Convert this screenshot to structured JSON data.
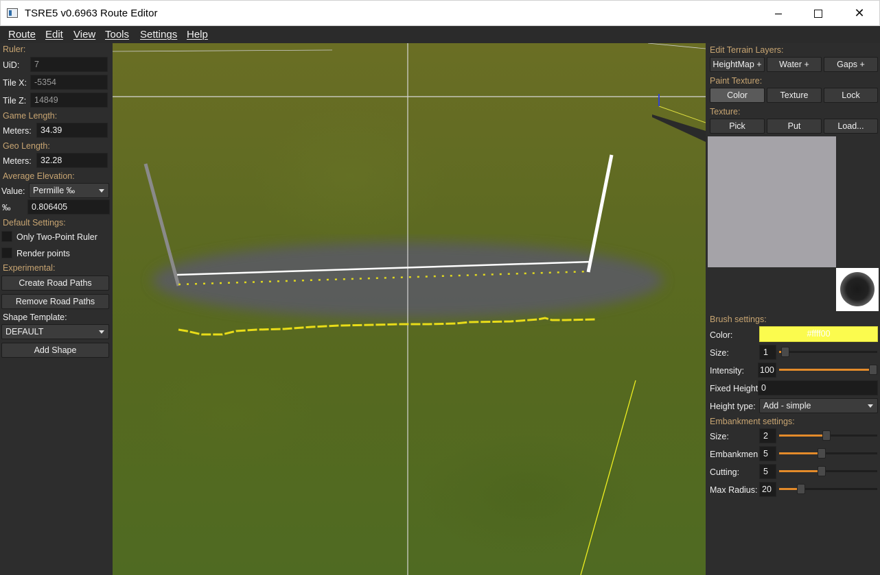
{
  "window": {
    "title": "TSRE5 v0.6963 Route Editor",
    "minimize": "–",
    "close": "✕"
  },
  "menu": [
    "Route",
    "Edit",
    "View",
    "Tools",
    "Settings",
    "Help"
  ],
  "left": {
    "ruler_header": "Ruler:",
    "uid_label": "UiD:",
    "uid_value": "7",
    "tilex_label": "Tile X:",
    "tilex_value": "-5354",
    "tilez_label": "Tile Z:",
    "tilez_value": "14849",
    "game_length_header": "Game Length:",
    "game_meters_label": "Meters:",
    "game_meters_value": "34.39",
    "geo_length_header": "Geo Length:",
    "geo_meters_label": "Meters:",
    "geo_meters_value": "32.28",
    "avg_elev_header": "Average Elevation:",
    "value_label": "Value:",
    "value_select": "Permille ‰",
    "permille_label": "‰",
    "permille_value": "0.806405",
    "default_settings_header": "Default Settings:",
    "only_two_point": "Only Two-Point Ruler",
    "render_points": "Render points",
    "experimental_header": "Experimental:",
    "create_road_paths": "Create Road Paths",
    "remove_road_paths": "Remove Road Paths",
    "shape_template_label": "Shape Template:",
    "shape_template_value": "DEFAULT",
    "add_shape": "Add Shape"
  },
  "right": {
    "edit_terrain_header": "Edit Terrain Layers:",
    "heightmap_btn": "HeightMap +",
    "water_btn": "Water +",
    "gaps_btn": "Gaps +",
    "paint_texture_header": "Paint Texture:",
    "color_btn": "Color",
    "texture_btn": "Texture",
    "lock_btn": "Lock",
    "texture_header": "Texture:",
    "pick_btn": "Pick",
    "put_btn": "Put",
    "load_btn": "Load...",
    "brush_header": "Brush settings:",
    "color_label": "Color:",
    "color_value": "#ffff00",
    "size_label": "Size:",
    "size_value": "1",
    "size_level": 0.02,
    "intensity_label": "Intensity:",
    "intensity_value": "100",
    "intensity_level": 1.0,
    "fixed_height_label": "Fixed Height",
    "fixed_height_value": "0",
    "height_type_label": "Height type:",
    "height_type_value": "Add - simple",
    "embankment_header": "Embankment settings:",
    "emb_size_label": "Size:",
    "emb_size_value": "2",
    "emb_size_level": 0.48,
    "embankment_label": "Embankmen",
    "embankment_value": "5",
    "embankment_level": 0.43,
    "cutting_label": "Cutting:",
    "cutting_value": "5",
    "cutting_level": 0.43,
    "max_radius_label": "Max Radius:",
    "max_radius_value": "20",
    "max_radius_level": 0.2
  },
  "colors": {
    "accent_orange": "#e48b2a",
    "section_label": "#c8a572",
    "brush_color": "#ffff00"
  }
}
